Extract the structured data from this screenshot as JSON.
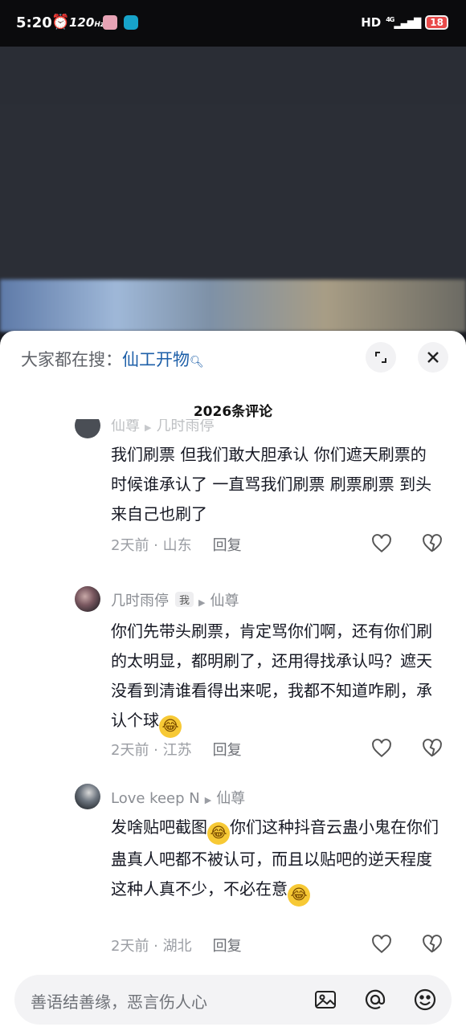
{
  "status_bar": {
    "time": "5:20",
    "refresh_rate": "120",
    "refresh_unit": "Hz",
    "network": "HD",
    "signal": "4G",
    "battery": "18"
  },
  "sheet": {
    "search_prefix": "大家都在搜：",
    "search_keyword": "仙工开物",
    "comment_count_title": "2026条评论"
  },
  "comments": [
    {
      "author": "仙尊",
      "reply_to": "几时雨停",
      "text": "我们刷票 但我们敢大胆承认 你们遮天刷票的时候谁承认了 一直骂我们刷票 刷票刷票 到头来自己也刷了",
      "time_location": "2天前 · 山东",
      "reply_label": "回复"
    },
    {
      "author": "几时雨停",
      "badge": "我",
      "reply_to": "仙尊",
      "text": "你们先带头刷票，肯定骂你们啊，还有你们刷的太明显，都明刷了，还用得找承认吗？遮天没看到清谁看得出来呢，我都不知道咋刷，承认个球",
      "time_location": "2天前 · 江苏",
      "reply_label": "回复"
    },
    {
      "author": "Love keep N",
      "reply_to": "仙尊",
      "text_part1": "发啥贴吧截图",
      "text_part2": "你们这种抖音云蛊小鬼在你们蛊真人吧都不被认可，而且以贴吧的逆天程度这种人真不少，不必在意",
      "time_location": "2天前 · 湖北",
      "reply_label": "回复"
    }
  ],
  "input": {
    "placeholder": "善语结善缘，恶言伤人心"
  },
  "icons": {
    "expand": "expand-icon",
    "close": "close-icon",
    "like": "heart-icon",
    "dislike": "broken-heart-icon",
    "image": "image-icon",
    "mention": "at-icon",
    "emoji": "smiley-icon",
    "laugh_emoji": "laughing-crying-emoji"
  },
  "colors": {
    "accent_link": "#1d5fa8",
    "battery_low": "#e84a4a"
  }
}
